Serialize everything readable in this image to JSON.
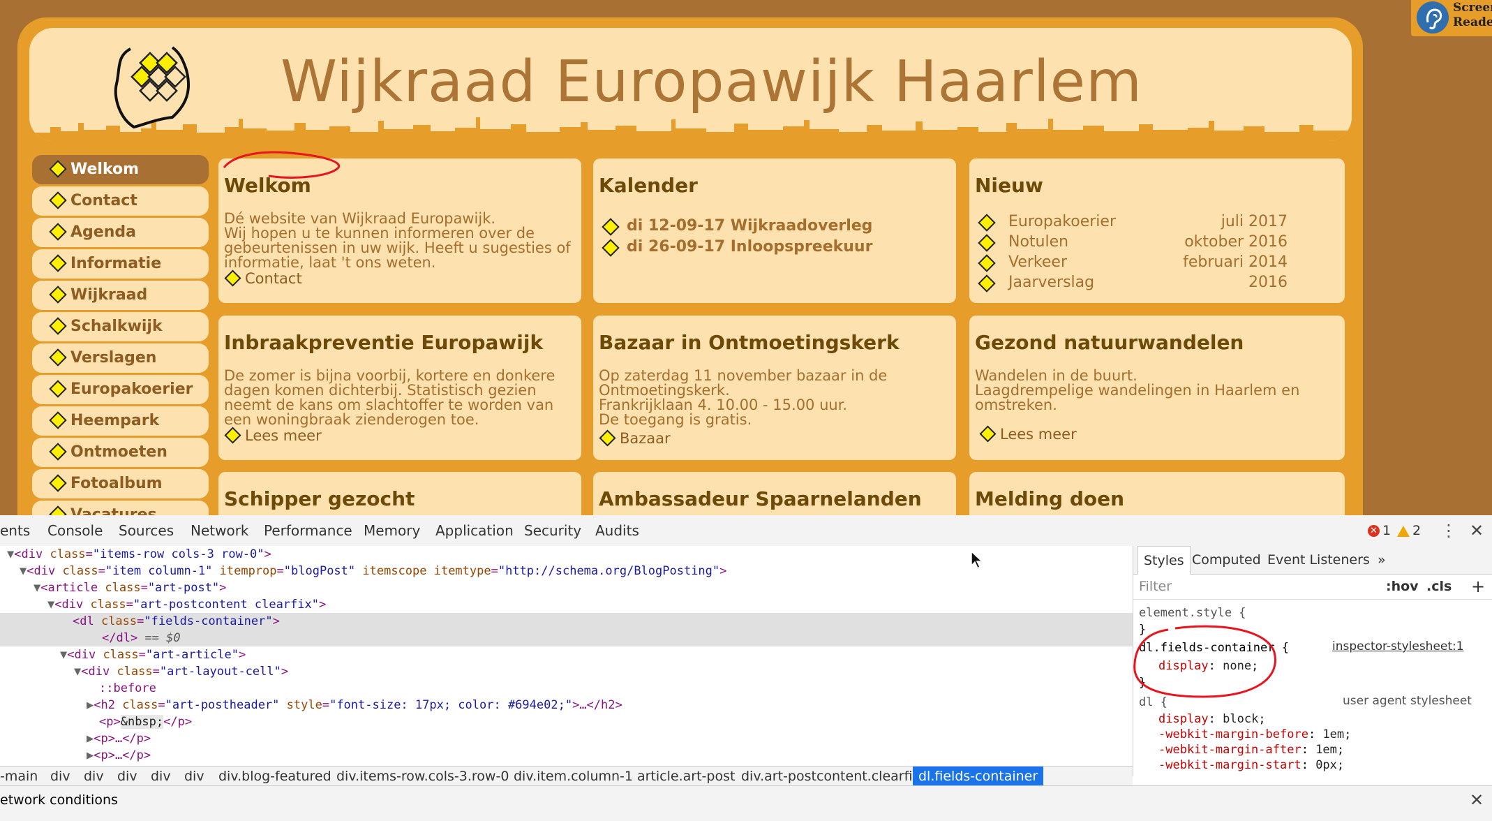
{
  "site": {
    "title": "Wijkraad Europawijk Haarlem",
    "screen_reader": [
      "Screen",
      "Reader"
    ],
    "nav": [
      "Welkom",
      "Contact",
      "Agenda",
      "Informatie",
      "Wijkraad",
      "Schalkwijk",
      "Verslagen",
      "Europakoerier",
      "Heempark",
      "Ontmoeten",
      "Fotoalbum",
      "Vacatures"
    ],
    "nav_active": "Welkom",
    "cards": {
      "welkom": {
        "title": "Welkom",
        "body": [
          "Dé website van Wijkraad Europawijk.",
          "Wij hopen u te kunnen informeren over de",
          "gebeurtenissen in uw wijk. Heeft u sugesties of",
          "informatie, laat 't ons weten."
        ],
        "link": "Contact"
      },
      "kalender": {
        "title": "Kalender",
        "events": [
          "di 12-09-17 Wijkraadoverleg",
          "di 26-09-17 Inloopspreekuur"
        ]
      },
      "nieuw": {
        "title": "Nieuw",
        "items": [
          {
            "label": "Europakoerier",
            "date": "juli 2017"
          },
          {
            "label": "Notulen",
            "date": "oktober 2016"
          },
          {
            "label": "Verkeer",
            "date": "februari 2014"
          },
          {
            "label": "Jaarverslag",
            "date": "2016"
          }
        ]
      },
      "inbraak": {
        "title": "Inbraakpreventie Europawijk",
        "body": [
          "De zomer is bijna voorbij, kortere en donkere",
          "dagen komen dichterbij. Statistisch gezien",
          "neemt de kans om slachtoffer te worden van",
          "een woningbraak zienderogen toe."
        ],
        "link": "Lees meer"
      },
      "bazaar": {
        "title": "Bazaar in Ontmoetingskerk",
        "body": [
          "Op zaterdag 11 november bazaar in de",
          "Ontmoetingskerk.",
          "Frankrijklaan 4. 10.00 - 15.00 uur.",
          "De toegang is gratis."
        ],
        "link": "Bazaar"
      },
      "natuur": {
        "title": "Gezond natuurwandelen",
        "body": [
          "Wandelen in de buurt.",
          "Laagdrempelige wandelingen in Haarlem en",
          "omstreken."
        ],
        "link": "Lees meer"
      },
      "schipper": {
        "title": "Schipper gezocht"
      },
      "ambassadeur": {
        "title": "Ambassadeur Spaarnelanden"
      },
      "melding": {
        "title": "Melding doen"
      }
    }
  },
  "devtools": {
    "tabs": [
      "ents",
      "Console",
      "Sources",
      "Network",
      "Performance",
      "Memory",
      "Application",
      "Security",
      "Audits"
    ],
    "errors": "1",
    "warnings": "2",
    "dom": [
      {
        "tri": "▼",
        "t1": "<div ",
        "a1": "class",
        "v1": "\"items-row cols-3 row-0\"",
        "t2": ">"
      },
      {
        "tri": "▼",
        "t1": "<div ",
        "a1": "class",
        "v1": "\"item column-1\"",
        "a2": " itemprop",
        "v2": "\"blogPost\"",
        "a3": " itemscope itemtype",
        "v3": "\"http://schema.org/BlogPosting\"",
        "t2": ">"
      },
      {
        "tri": "▼",
        "t1": "<article ",
        "a1": "class",
        "v1": "\"art-post\"",
        "t2": ">"
      },
      {
        "tri": "▼",
        "t1": "<div ",
        "a1": "class",
        "v1": "\"art-postcontent clearfix\"",
        "t2": ">"
      },
      {
        "tri": "",
        "t1": "<dl ",
        "a1": "class",
        "v1": "\"fields-container\"",
        "t2": ">"
      },
      {
        "tri": "",
        "t1": "</dl>",
        "extra": " == $0"
      },
      {
        "tri": "▼",
        "t1": "<div ",
        "a1": "class",
        "v1": "\"art-article\"",
        "t2": ">"
      },
      {
        "tri": "▼",
        "t1": "<div ",
        "a1": "class",
        "v1": "\"art-layout-cell\"",
        "t2": ">"
      },
      {
        "tri": "",
        "pseudo": "::before"
      },
      {
        "tri": "▶",
        "t1": "<h2 ",
        "a1": "class",
        "v1": "\"art-postheader\"",
        "a2": " style",
        "v2": "\"font-size: 17px; color: #694e02;\"",
        "t2": ">…</h2>"
      },
      {
        "tri": "",
        "t1": "<p>",
        "txt": "&nbsp;",
        "t3": "</p>"
      },
      {
        "tri": "▶",
        "t1": "<p>…</p>"
      },
      {
        "tri": "▶",
        "t1": "<p>…</p>"
      }
    ],
    "breadcrumbs": [
      "-main",
      "div",
      "div",
      "div",
      "div",
      "div",
      "div.blog-featured",
      "div.items-row.cols-3.row-0",
      "div.item.column-1",
      "article.art-post",
      "div.art-postcontent.clearfix",
      "dl.fields-container"
    ],
    "styles_tabs": [
      "Styles",
      "Computed",
      "Event Listeners",
      "»"
    ],
    "filter_placeholder": "Filter",
    "hov": ":hov",
    "cls": ".cls",
    "plus": "+",
    "element_style": "element.style {",
    "close_brace": "}",
    "rule1": {
      "selector": "dl.fields-container {",
      "source": "inspector-stylesheet:1",
      "prop": "display",
      "value": "none;"
    },
    "rule2": {
      "selector": "dl {",
      "source": "user agent stylesheet",
      "props": [
        {
          "prop": "display",
          "value": "block;"
        },
        {
          "prop": "-webkit-margin-before",
          "value": "1em;"
        },
        {
          "prop": "-webkit-margin-after",
          "value": "1em;"
        },
        {
          "prop": "-webkit-margin-start",
          "value": "0px;"
        }
      ]
    },
    "network_conditions": "etwork conditions"
  }
}
